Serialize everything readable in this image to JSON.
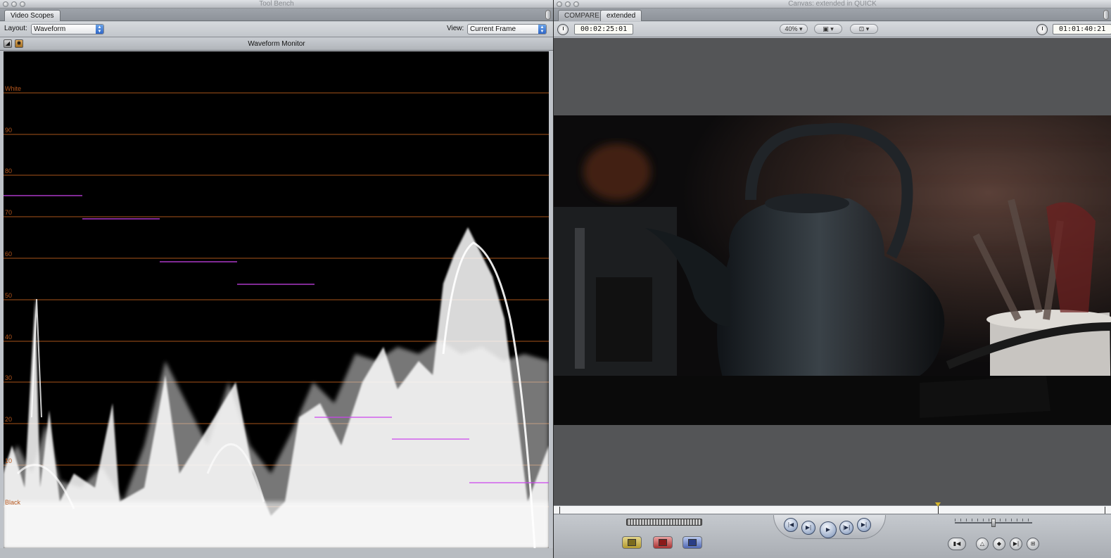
{
  "toolbench": {
    "window_title": "Tool Bench",
    "tab": "Video Scopes",
    "layout_label": "Layout:",
    "layout_value": "Waveform",
    "view_label": "View:",
    "view_value": "Current Frame",
    "scope_title": "Waveform Monitor",
    "scale_labels": [
      "White",
      "90",
      "80",
      "70",
      "60",
      "50",
      "40",
      "30",
      "20",
      "10",
      "Black"
    ]
  },
  "canvas": {
    "window_title": "Canvas: extended in QUICK",
    "tabs": [
      "COMPARE",
      "extended"
    ],
    "duration_timecode": "00:02:25:01",
    "zoom": "40%",
    "current_timecode": "01:01:40:21",
    "playhead_fraction": 0.69
  },
  "icons": {
    "clock": "clock-icon",
    "view_mode": "view-mode-icon",
    "overlay": "overlay-icon"
  }
}
